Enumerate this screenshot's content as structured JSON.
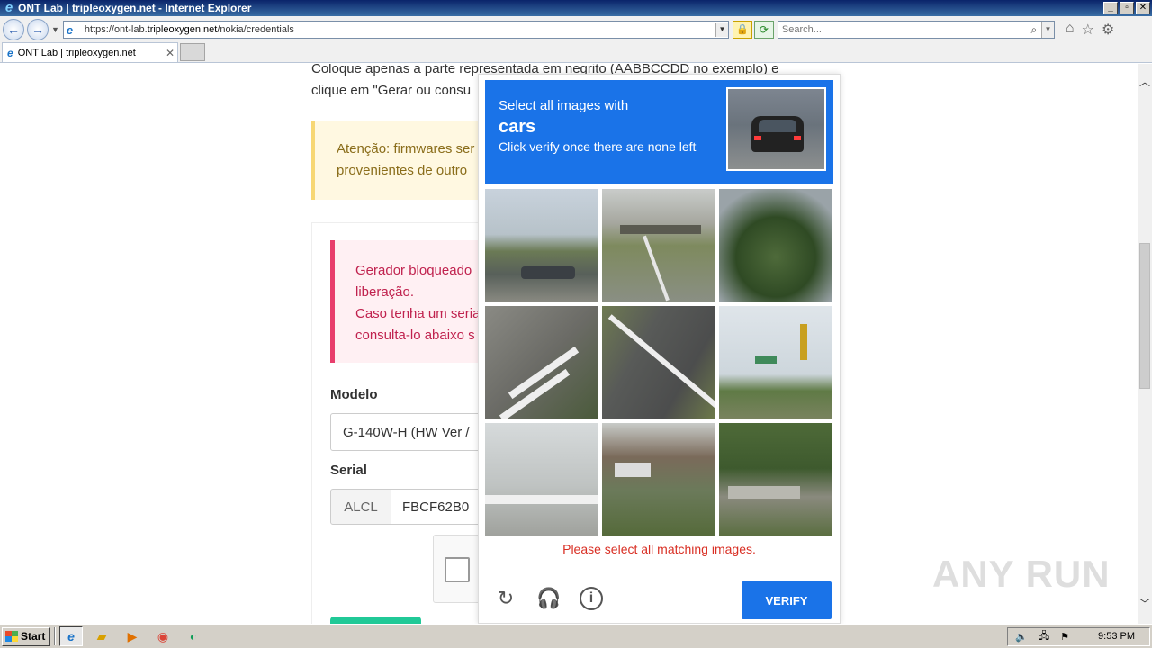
{
  "window": {
    "title": "ONT Lab | tripleoxygen.net - Internet Explorer"
  },
  "addressbar": {
    "url_prefix": "https://ont-lab.",
    "url_host": "tripleoxygen.net",
    "url_path": "/nokia/credentials",
    "search_placeholder": "Search..."
  },
  "tabs": [
    {
      "label": "ONT Lab | tripleoxygen.net"
    }
  ],
  "page": {
    "intro_line1": "Coloque apenas a parte representada em negrito (AABBCCDD no exemplo) e",
    "intro_line2": "clique em \"Gerar ou consu",
    "warning_line1": "Atenção: firmwares ser",
    "warning_line2": "provenientes de outro",
    "error_line1": "Gerador bloqueado",
    "error_line2": "liberação.",
    "error_line3": "Caso tenha um seria",
    "error_line4": "consulta-lo abaixo s",
    "modelo_label": "Modelo",
    "modelo_value": "G-140W-H (HW Ver /",
    "serial_label": "Serial",
    "serial_prefix": "ALCL",
    "serial_value": "FBCF62B0"
  },
  "captcha": {
    "prompt": "Select all images with",
    "subject": "cars",
    "instruction": "Click verify once there are none left",
    "error": "Please select all matching images.",
    "verify_label": "VERIFY",
    "tiles": 9
  },
  "watermark": "ANY RUN",
  "taskbar": {
    "start_label": "Start",
    "clock": "9:53 PM"
  },
  "colors": {
    "captcha_blue": "#1a73e8",
    "error_red": "#d93025",
    "warning_bg": "#fff8e1",
    "alert_bg": "#fff0f3",
    "alert_border": "#e83e6c",
    "submit_green": "#20c997"
  }
}
